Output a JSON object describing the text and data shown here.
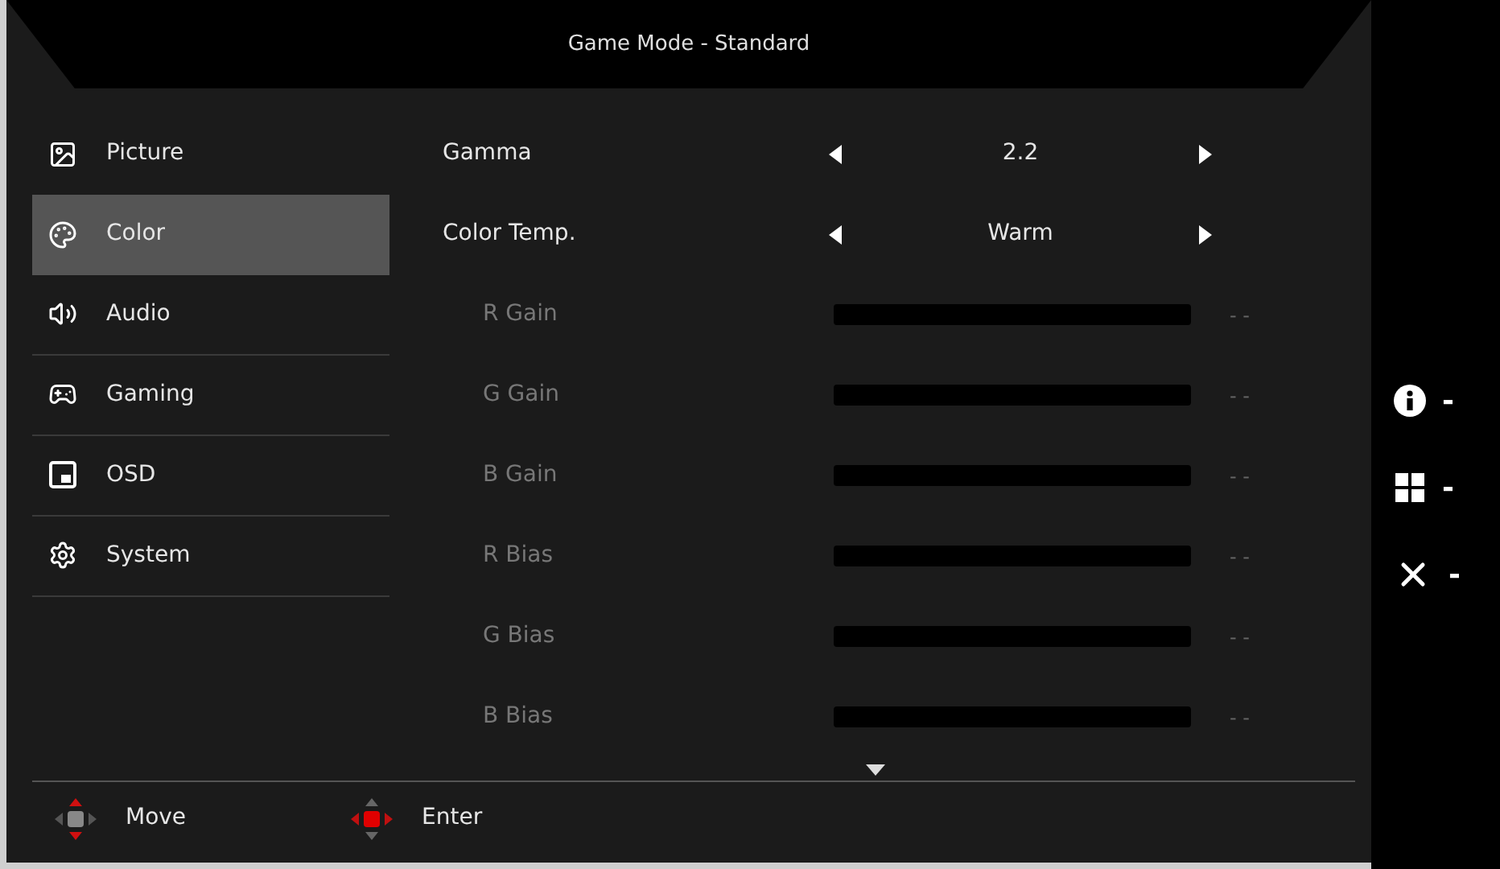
{
  "header": {
    "title": "Game Mode - Standard"
  },
  "menu": [
    {
      "kind": "picture",
      "label": "Picture",
      "selected": false
    },
    {
      "kind": "color",
      "label": "Color",
      "selected": true
    },
    {
      "kind": "audio",
      "label": "Audio",
      "selected": false
    },
    {
      "kind": "gaming",
      "label": "Gaming",
      "selected": false
    },
    {
      "kind": "osd",
      "label": "OSD",
      "selected": false
    },
    {
      "kind": "system",
      "label": "System",
      "selected": false
    }
  ],
  "settings": [
    {
      "kind": "option",
      "label": "Gamma",
      "value": "2.2",
      "disabled": false
    },
    {
      "kind": "option",
      "label": "Color Temp.",
      "value": "Warm",
      "disabled": false
    },
    {
      "kind": "slider",
      "label": "R Gain",
      "reading": "- -",
      "disabled": true
    },
    {
      "kind": "slider",
      "label": "G Gain",
      "reading": "- -",
      "disabled": true
    },
    {
      "kind": "slider",
      "label": "B Gain",
      "reading": "- -",
      "disabled": true
    },
    {
      "kind": "slider",
      "label": "R Bias",
      "reading": "- -",
      "disabled": true
    },
    {
      "kind": "slider",
      "label": "G Bias",
      "reading": "- -",
      "disabled": true
    },
    {
      "kind": "slider",
      "label": "B Bias",
      "reading": "- -",
      "disabled": true
    }
  ],
  "footer": [
    {
      "kind": "move",
      "label": "Move"
    },
    {
      "kind": "enter",
      "label": "Enter"
    }
  ],
  "hotkeys": [
    {
      "kind": "info",
      "label": "-"
    },
    {
      "kind": "mode",
      "label": "-"
    },
    {
      "kind": "close",
      "label": "-"
    }
  ]
}
